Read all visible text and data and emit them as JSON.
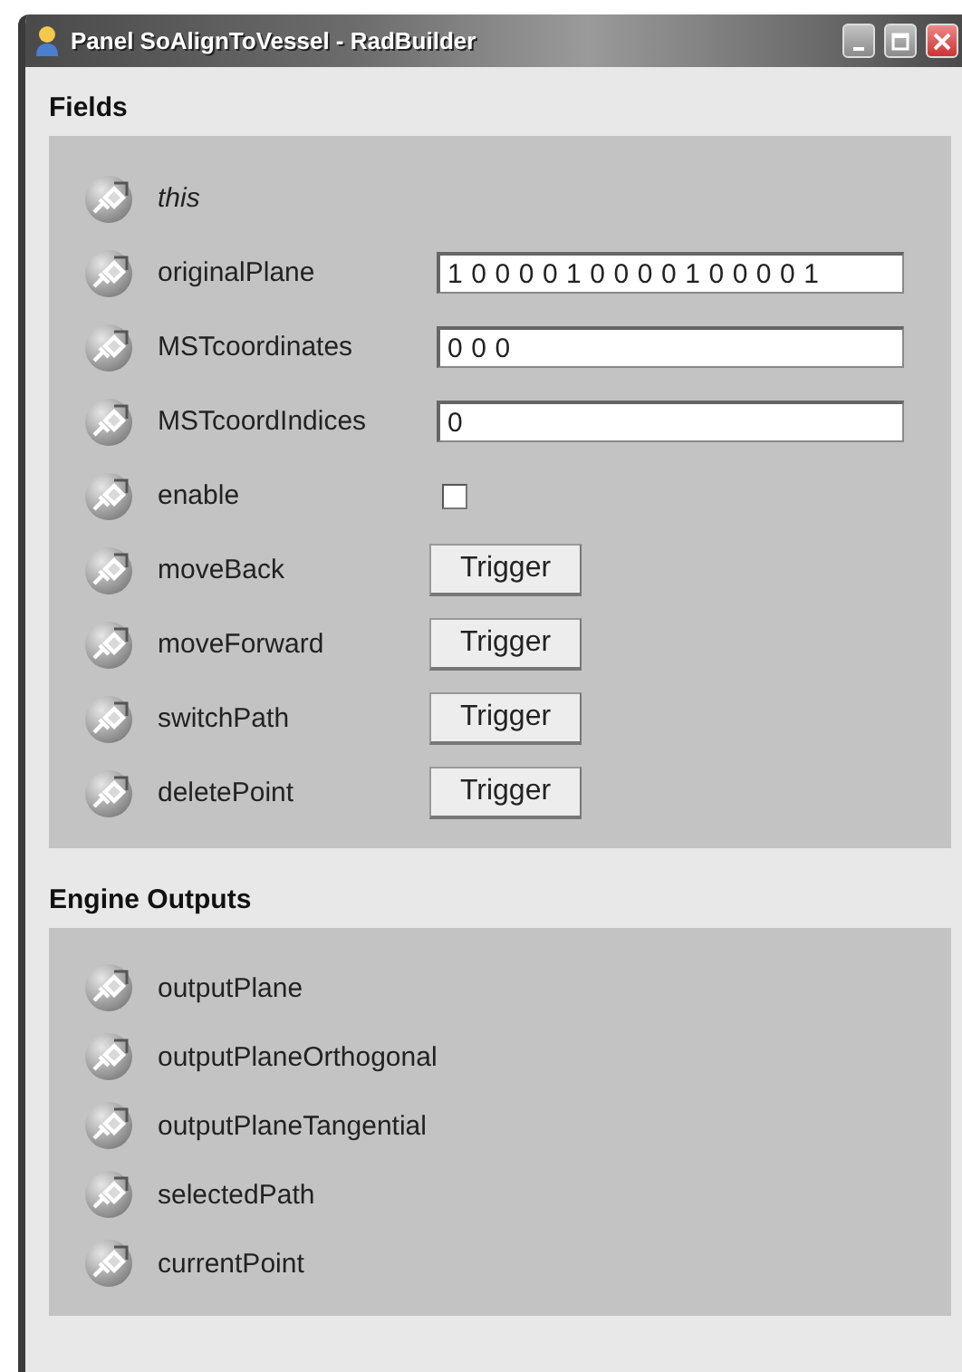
{
  "window": {
    "title": "Panel SoAlignToVessel - RadBuilder"
  },
  "sections": [
    {
      "heading": "Fields",
      "rows": [
        {
          "kind": "self",
          "label": "this"
        },
        {
          "kind": "text",
          "label": "originalPlane",
          "value": "1 0 0 0 0 1 0 0 0 0 1 0 0 0 0 1"
        },
        {
          "kind": "text",
          "label": "MSTcoordinates",
          "value": "0 0 0"
        },
        {
          "kind": "text",
          "label": "MSTcoordIndices",
          "value": "0"
        },
        {
          "kind": "checkbox",
          "label": "enable",
          "checked": false
        },
        {
          "kind": "trigger",
          "label": "moveBack",
          "button": "Trigger"
        },
        {
          "kind": "trigger",
          "label": "moveForward",
          "button": "Trigger"
        },
        {
          "kind": "trigger",
          "label": "switchPath",
          "button": "Trigger"
        },
        {
          "kind": "trigger",
          "label": "deletePoint",
          "button": "Trigger"
        }
      ]
    },
    {
      "heading": "Engine Outputs",
      "rows": [
        {
          "kind": "output",
          "label": "outputPlane"
        },
        {
          "kind": "output",
          "label": "outputPlaneOrthogonal"
        },
        {
          "kind": "output",
          "label": "outputPlaneTangential"
        },
        {
          "kind": "output",
          "label": "selectedPath"
        },
        {
          "kind": "output",
          "label": "currentPoint"
        }
      ]
    }
  ]
}
